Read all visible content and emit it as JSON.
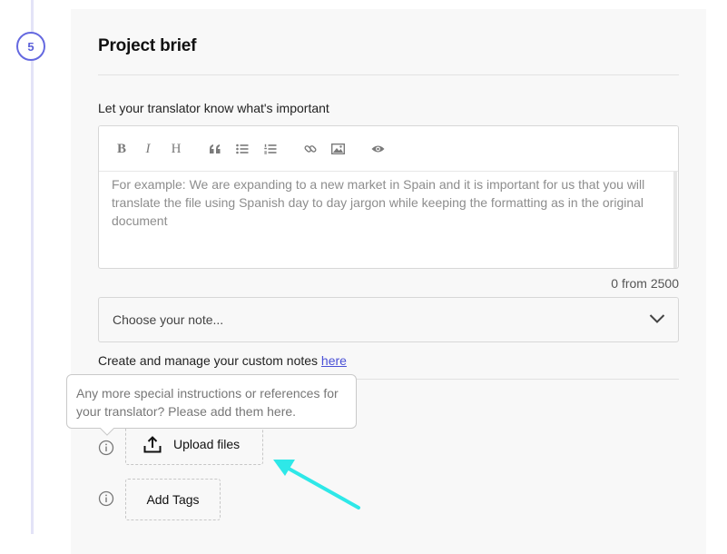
{
  "step": {
    "number": "5"
  },
  "section": {
    "title": "Project brief"
  },
  "instructions": {
    "label": "Let your translator know what's important",
    "placeholder": "For example: We are expanding to a new market in Spain and it is important for us that you will translate the file using Spanish day to day jargon while keeping the formatting as in the original document",
    "counter": "0 from 2500"
  },
  "toolbar": {
    "bold": "B",
    "italic": "I",
    "heading": "H"
  },
  "note_select": {
    "placeholder": "Choose your note..."
  },
  "notes": {
    "text": "Create and manage your custom notes ",
    "link": "here"
  },
  "tooltip": {
    "text": "Any more special instructions or references for your translator? Please add them here."
  },
  "upload": {
    "label": "Upload files"
  },
  "tags": {
    "label": "Add Tags"
  },
  "colors": {
    "accent": "#5a5fd8",
    "annotation_arrow": "#2ee8e8"
  }
}
